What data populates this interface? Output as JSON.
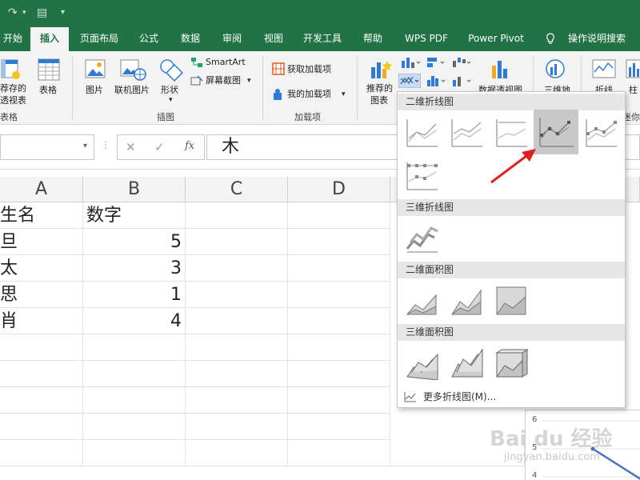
{
  "tabs": {
    "items": [
      "开始",
      "插入",
      "页面布局",
      "公式",
      "数据",
      "审阅",
      "视图",
      "开发工具",
      "帮助",
      "WPS PDF",
      "Power Pivot"
    ],
    "active": "插入",
    "tell_me": "操作说明搜索"
  },
  "ribbon": {
    "tables_group": {
      "recommended_pivot_line1": "荐存的",
      "recommended_pivot_line2": "透视表",
      "table_label": "表格",
      "group_label": "表格"
    },
    "illustrations_group": {
      "picture": "图片",
      "online_picture": "联机图片",
      "shapes": "形状",
      "smartart": "SmartArt",
      "screenshot": "屏幕截图",
      "group_label": "插图"
    },
    "addins_group": {
      "get_addins": "获取加载项",
      "my_addins": "我的加载项",
      "group_label": "加载项"
    },
    "charts_group": {
      "recommended_line1": "推荐的",
      "recommended_line2": "图表",
      "pivot_chart": "数据透视图",
      "map_3d": "三维地",
      "line_sparkline": "折线",
      "column_sparkline": "柱",
      "sparkline_group": "迷你"
    }
  },
  "formula_bar": {
    "cancel_glyph": "✕",
    "enter_glyph": "✓",
    "fx": "fx",
    "content": "木"
  },
  "sheet": {
    "columns": [
      "A",
      "B",
      "C",
      "D"
    ],
    "rows": [
      {
        "a": "生名",
        "b": "数字"
      },
      {
        "a": "旦",
        "b": "5"
      },
      {
        "a": "太",
        "b": "3"
      },
      {
        "a": "思",
        "b": "1"
      },
      {
        "a": "肖",
        "b": "4"
      }
    ]
  },
  "dropdown": {
    "sections": [
      "二维折线图",
      "三维折线图",
      "二维面积图",
      "三维面积图"
    ],
    "more": "更多折线图(M)..."
  },
  "chart_preview": {
    "ticks": [
      "6",
      "5",
      "4"
    ]
  },
  "watermark": {
    "main": "Bai du 经验",
    "sub": "jingyan.baidu.com"
  },
  "colors": {
    "brand": "#217346",
    "ribbon_bg": "#f3f3f3",
    "arrow": "#e02020",
    "selected_thumb": "#c8c8c8"
  }
}
